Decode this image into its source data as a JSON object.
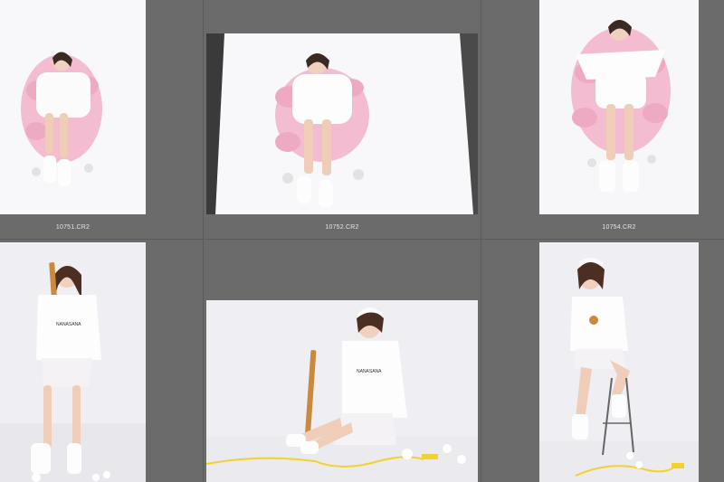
{
  "grid": {
    "background": "#6b6b6b",
    "thumbnails": [
      {
        "filename": "10751.CR2",
        "description_icon": "photo-thumbnail"
      },
      {
        "filename": "10752.CR2",
        "description_icon": "photo-thumbnail"
      },
      {
        "filename": "10754.CR2",
        "description_icon": "photo-thumbnail"
      },
      {
        "filename": "",
        "description_icon": "photo-thumbnail"
      },
      {
        "filename": "",
        "description_icon": "photo-thumbnail"
      },
      {
        "filename": "",
        "description_icon": "photo-thumbnail"
      }
    ]
  },
  "colors": {
    "pink": "#f3bcd0",
    "white_backdrop": "#f6f6f8",
    "rope": "#f2d22e",
    "bat": "#c98a3e"
  }
}
